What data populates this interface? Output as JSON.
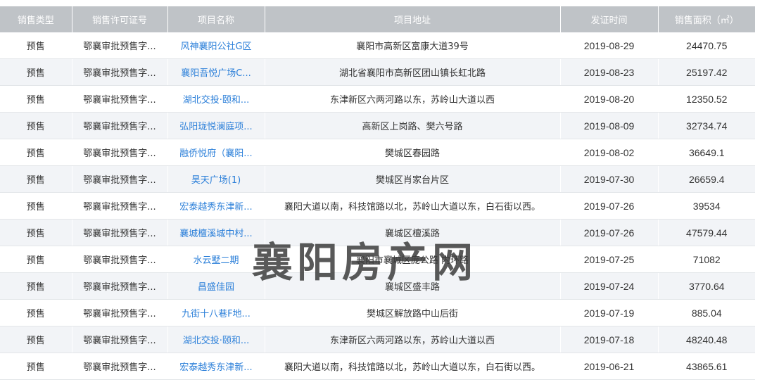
{
  "columns": [
    "销售类型",
    "销售许可证号",
    "项目名称",
    "项目地址",
    "发证时间",
    "销售面积（㎡）"
  ],
  "rows": [
    [
      "预售",
      "鄂襄审批预售字...",
      "风神襄阳公社G区",
      "襄阳市高新区富康大道39号",
      "2019-08-29",
      "24470.75"
    ],
    [
      "预售",
      "鄂襄审批预售字...",
      "襄阳吾悦广场C...",
      "湖北省襄阳市高新区团山镇长虹北路",
      "2019-08-23",
      "25197.42"
    ],
    [
      "预售",
      "鄂襄审批预售字...",
      "湖北交投·颐和...",
      "东津新区六两河路以东，苏岭山大道以西",
      "2019-08-20",
      "12350.52"
    ],
    [
      "预售",
      "鄂襄审批预售字...",
      "弘阳珑悦澜庭项...",
      "高新区上岗路、樊六号路",
      "2019-08-09",
      "32734.74"
    ],
    [
      "预售",
      "鄂襄审批预售字...",
      "融侨悦府（襄阳...",
      "樊城区春园路",
      "2019-08-02",
      "36649.1"
    ],
    [
      "预售",
      "鄂襄审批预售字...",
      "昊天广场(1)",
      "樊城区肖家台片区",
      "2019-07-30",
      "26659.4"
    ],
    [
      "预售",
      "鄂襄审批预售字...",
      "宏泰越秀东津新...",
      "襄阳大道以南，科技馆路以北，苏岭山大道以东，白石街以西。",
      "2019-07-26",
      "39534"
    ],
    [
      "预售",
      "鄂襄审批预售字...",
      "襄城檀溪城中村...",
      "襄城区檀溪路",
      "2019-07-26",
      "47579.44"
    ],
    [
      "预售",
      "鄂襄审批预售字...",
      "水云墅二期",
      "襄阳市襄城区庞公路 内环路",
      "2019-07-25",
      "71082"
    ],
    [
      "预售",
      "鄂襄审批预售字...",
      "昌盛佳园",
      "襄城区盛丰路",
      "2019-07-24",
      "3770.64"
    ],
    [
      "预售",
      "鄂襄审批预售字...",
      "九街十八巷F地...",
      "樊城区解放路中山后街",
      "2019-07-19",
      "885.04"
    ],
    [
      "预售",
      "鄂襄审批预售字...",
      "湖北交投·颐和...",
      "东津新区六两河路以东，苏岭山大道以西",
      "2019-07-18",
      "48240.48"
    ],
    [
      "预售",
      "鄂襄审批预售字...",
      "宏泰越秀东津新...",
      "襄阳大道以南，科技馆路以北，苏岭山大道以东，白石街以西。",
      "2019-06-21",
      "43865.61"
    ]
  ],
  "watermark": "襄阳房产网",
  "colors": {
    "header_bg": "#bfc3c7",
    "link": "#2b7fd9",
    "even_row": "#f2f4f7"
  }
}
